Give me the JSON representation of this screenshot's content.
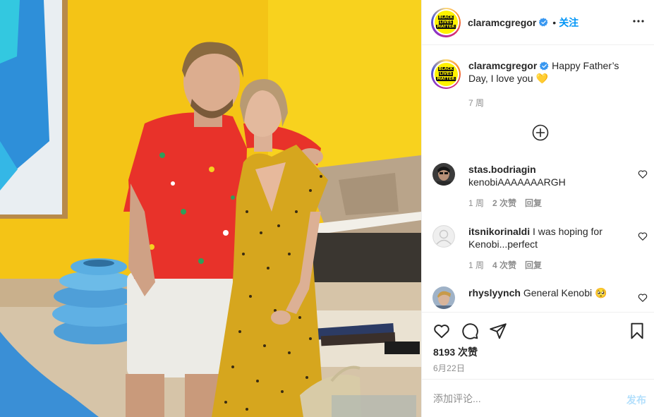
{
  "header": {
    "username": "claramcgregor",
    "separator": "•",
    "follow_label": "关注",
    "more_label": "•••",
    "avatar_text": [
      "BLACK",
      "LIVES",
      "MATTER"
    ]
  },
  "caption": {
    "username": "claramcgregor",
    "text": "Happy Father’s Day, I love you",
    "emoji": "💛",
    "time": "7 周"
  },
  "comments": [
    {
      "username": "stas.bodriagin",
      "text": "kenobiAAAAAAARGH",
      "time": "1 周",
      "likes": "2 次赞",
      "reply": "回复"
    },
    {
      "username": "itsnikorinaldi",
      "text": "I was hoping for Kenobi...perfect",
      "time": "1 周",
      "likes": "4 次赞",
      "reply": "回复"
    },
    {
      "username": "rhyslyynch",
      "text": "General Kenobi",
      "emoji": "🥺"
    }
  ],
  "actions": {
    "likes_count": "8193 次赞",
    "date": "6月22日"
  },
  "add_comment": {
    "placeholder": "添加评论...",
    "post_label": "发布"
  },
  "icons": {
    "verified": "verified-badge-icon",
    "more": "more-options-icon",
    "load_more": "plus-circle-icon",
    "like": "heart-icon",
    "comment": "comment-icon",
    "share": "share-icon",
    "save": "bookmark-icon"
  },
  "colors": {
    "link_blue": "#0095f6",
    "post_button_disabled": "#b2dffc",
    "muted_text": "#8e8e8e",
    "border": "#efefef",
    "photo_wall_yellow": "#f6c71a"
  }
}
